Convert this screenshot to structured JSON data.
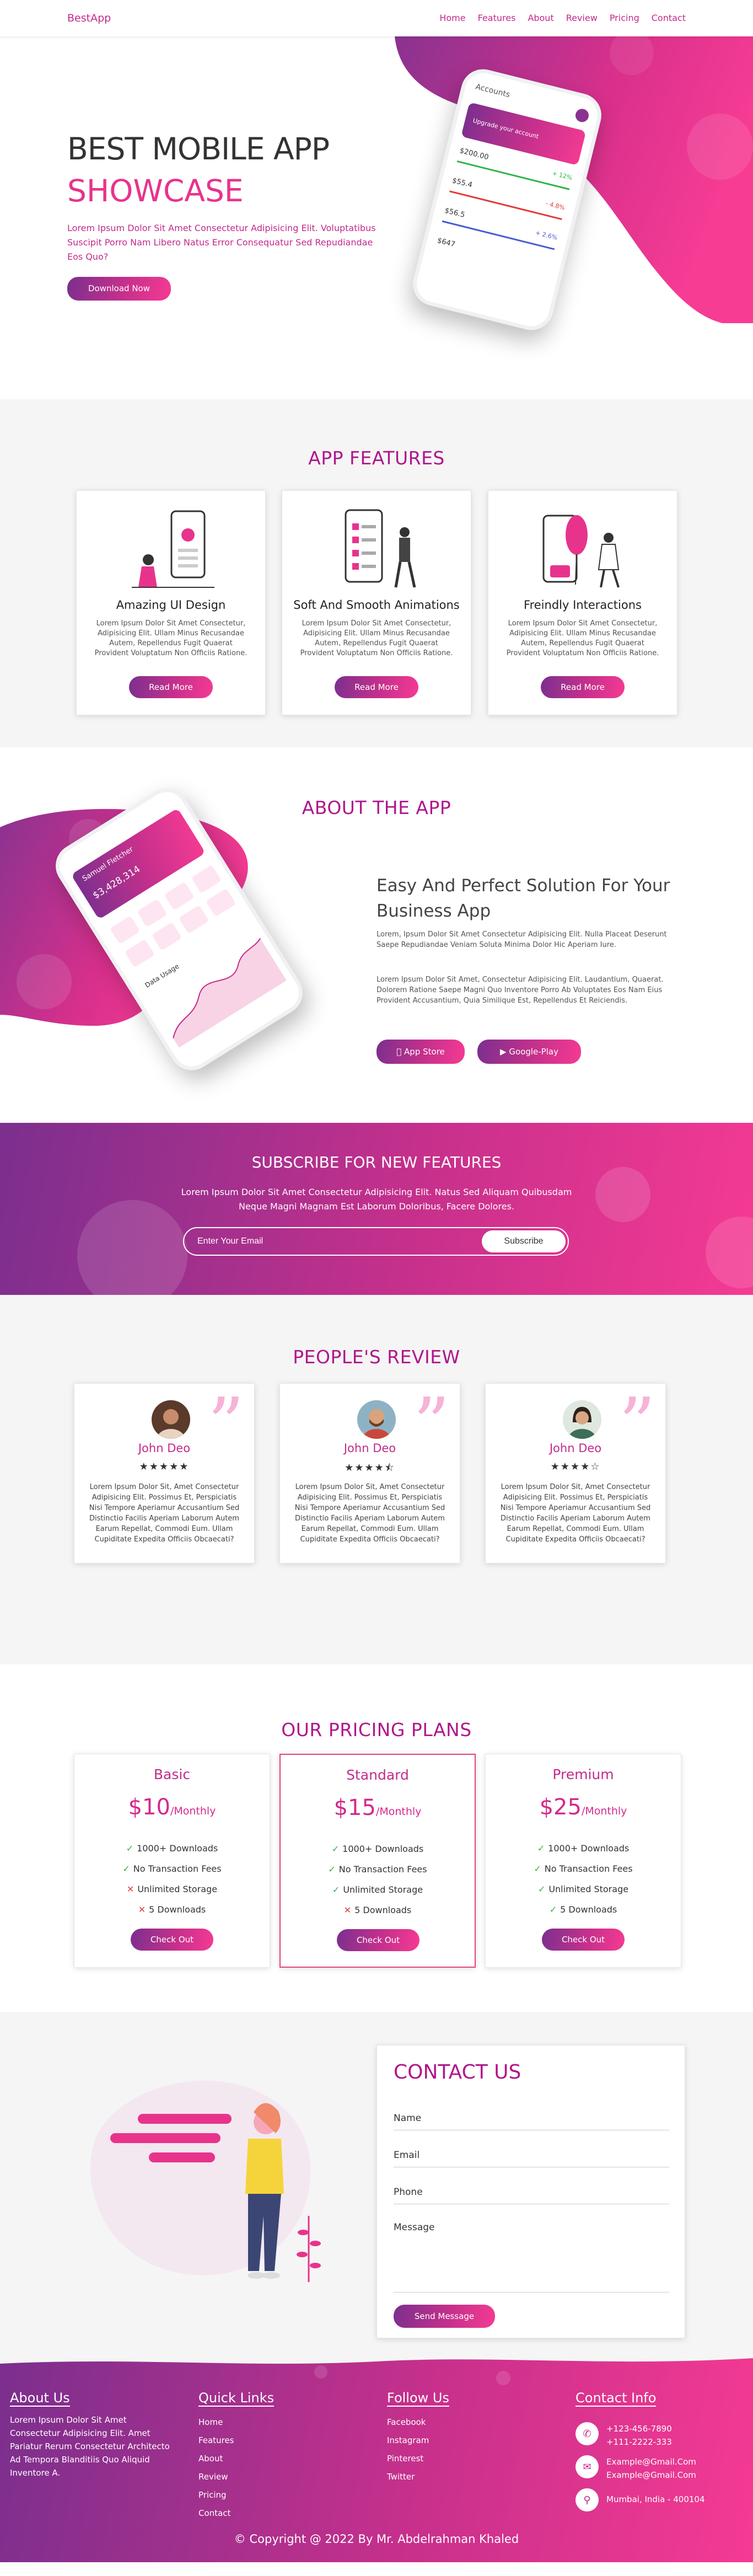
{
  "header": {
    "logo": "BestApp",
    "nav": [
      "Home",
      "Features",
      "About",
      "Review",
      "Pricing",
      "Contact"
    ]
  },
  "hero": {
    "title": "BEST MOBILE APP",
    "title_accent": "SHOWCASE",
    "text": "Lorem Ipsum Dolor Sit Amet Consectetur Adipisicing Elit. Voluptatibus Suscipit Porro Nam Libero Natus Error Consequatur Sed Repudiandae Eos Quo?",
    "button": "Download Now",
    "phone": {
      "title": "Accounts",
      "banner": "Upgrade your account",
      "values": [
        "$200.00",
        "$55.4",
        "$56.5",
        "$647"
      ],
      "changes": [
        "+ 12%",
        "- 4.8%",
        "+ 2.6%"
      ]
    }
  },
  "features": {
    "title": "APP FEATURES",
    "items": [
      {
        "title": "Amazing UI Design",
        "text": "Lorem Ipsum Dolor Sit Amet Consectetur, Adipisicing Elit. Ullam Minus Recusandae Autem, Repellendus Fugit Quaerat Provident Voluptatum Non Officiis Ratione.",
        "button": "Read More"
      },
      {
        "title": "Soft And Smooth Animations",
        "text": "Lorem Ipsum Dolor Sit Amet Consectetur, Adipisicing Elit. Ullam Minus Recusandae Autem, Repellendus Fugit Quaerat Provident Voluptatum Non Officiis Ratione.",
        "button": "Read More"
      },
      {
        "title": "Freindly Interactions",
        "text": "Lorem Ipsum Dolor Sit Amet Consectetur, Adipisicing Elit. Ullam Minus Recusandae Autem, Repellendus Fugit Quaerat Provident Voluptatum Non Officiis Ratione.",
        "button": "Read More"
      }
    ]
  },
  "about": {
    "title": "ABOUT THE APP",
    "heading": "Easy And Perfect Solution For Your Business App",
    "p1": "Lorem, Ipsum Dolor Sit Amet Consectetur Adipisicing Elit. Nulla Placeat Deserunt Saepe Repudiandae Veniam Soluta Minima Dolor Hic Aperiam Iure.",
    "p2": "Lorem Ipsum Dolor Sit Amet, Consectetur Adipisicing Elit. Laudantium, Quaerat. Dolorem Ratione Saepe Magni Quo Inventore Porro Ab Voluptates Eos Nam Eius Provident Accusantium, Quia Similique Est, Repellendus Et Reiciendis.",
    "btn_appstore": "App Store",
    "btn_googleplay": "Google-Play",
    "phone": {
      "name": "Samuel Fletcher",
      "amount": "$3,428,314",
      "chart_label": "Data Usage"
    }
  },
  "subscribe": {
    "title": "SUBSCRIBE FOR NEW FEATURES",
    "text": "Lorem Ipsum Dolor Sit Amet Consectetur Adipisicing Elit. Natus Sed Aliquam Quibusdam Neque Magni Magnam Est Laborum Doloribus, Facere Dolores.",
    "placeholder": "Enter Your Email",
    "button": "Subscribe"
  },
  "review": {
    "title": "PEOPLE'S REVIEW",
    "items": [
      {
        "name": "John Deo",
        "stars": "★★★★★",
        "rating": 5,
        "text": "Lorem Ipsum Dolor Sit, Amet Consectetur Adipisicing Elit. Possimus Et, Perspiciatis Nisi Tempore Aperiamur Accusantium Sed Distinctio Facilis Aperiam Laborum Autem Earum Repellat, Commodi Eum. Ullam Cupiditate Expedita Officiis Obcaecati?"
      },
      {
        "name": "John Deo",
        "stars": "★★★★⯪",
        "rating": 4.5,
        "text": "Lorem Ipsum Dolor Sit, Amet Consectetur Adipisicing Elit. Possimus Et, Perspiciatis Nisi Tempore Aperiamur Accusantium Sed Distinctio Facilis Aperiam Laborum Autem Earum Repellat, Commodi Eum. Ullam Cupiditate Expedita Officiis Obcaecati?"
      },
      {
        "name": "John Deo",
        "stars": "★★★★☆",
        "rating": 4,
        "text": "Lorem Ipsum Dolor Sit, Amet Consectetur Adipisicing Elit. Possimus Et, Perspiciatis Nisi Tempore Aperiamur Accusantium Sed Distinctio Facilis Aperiam Laborum Autem Earum Repellat, Commodi Eum. Ullam Cupiditate Expedita Officiis Obcaecati?"
      }
    ]
  },
  "pricing": {
    "title": "OUR PRICING PLANS",
    "plans": [
      {
        "name": "Basic",
        "price": "$10",
        "period": "/Monthly",
        "button": "Check Out",
        "features": [
          {
            "ok": true,
            "text": "1000+ Downloads"
          },
          {
            "ok": true,
            "text": "No Transaction Fees"
          },
          {
            "ok": false,
            "text": "Unlimited Storage"
          },
          {
            "ok": false,
            "text": "5 Downloads"
          }
        ]
      },
      {
        "name": "Standard",
        "price": "$15",
        "period": "/Monthly",
        "button": "Check Out",
        "features": [
          {
            "ok": true,
            "text": "1000+ Downloads"
          },
          {
            "ok": true,
            "text": "No Transaction Fees"
          },
          {
            "ok": true,
            "text": "Unlimited Storage"
          },
          {
            "ok": false,
            "text": "5 Downloads"
          }
        ]
      },
      {
        "name": "Premium",
        "price": "$25",
        "period": "/Monthly",
        "button": "Check Out",
        "features": [
          {
            "ok": true,
            "text": "1000+ Downloads"
          },
          {
            "ok": true,
            "text": "No Transaction Fees"
          },
          {
            "ok": true,
            "text": "Unlimited Storage"
          },
          {
            "ok": true,
            "text": "5 Downloads"
          }
        ]
      }
    ]
  },
  "contact": {
    "title": "CONTACT US",
    "name": "Name",
    "email": "Email",
    "phone": "Phone",
    "message": "Message",
    "button": "Send Message"
  },
  "footer": {
    "about_title": "About Us",
    "about_text": "Lorem Ipsum Dolor Sit Amet Consectetur Adipisicing Elit. Amet Pariatur Rerum Consectetur Architecto Ad Tempora Blanditiis Quo Aliquid Inventore A.",
    "links_title": "Quick Links",
    "links": [
      "Home",
      "Features",
      "About",
      "Review",
      "Pricing",
      "Contact"
    ],
    "follow_title": "Follow Us",
    "follow": [
      "Facebook",
      "Instagram",
      "Pinterest",
      "Twitter"
    ],
    "info_title": "Contact Info",
    "phone1": "+123-456-7890",
    "phone2": "+111-2222-333",
    "email1": "Example@Gmail.Com",
    "email2": "Example@Gmail.Com",
    "address": "Mumbai, India - 400104",
    "copyright": "© Copyright @ 2022 By Mr. Abdelrahman Khaled"
  },
  "colors": {
    "primary": "#c32a8b",
    "gradient_start": "#7b2f8e",
    "gradient_end": "#f53a93",
    "check": "#2fb44b",
    "cross": "#e23a3a"
  },
  "icons": {
    "check": "check-icon",
    "cross": "cross-icon",
    "apple": "apple-icon",
    "play": "play-icon",
    "phone": "phone-icon",
    "envelope": "envelope-icon",
    "location": "location-icon"
  }
}
